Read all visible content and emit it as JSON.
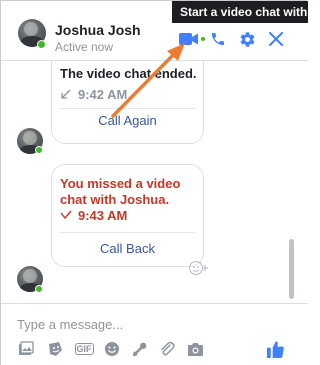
{
  "header": {
    "contact_name": "Joshua Josh",
    "status": "Active now",
    "tooltip": "Start a video chat with",
    "icons": [
      "video-camera-icon",
      "phone-icon",
      "gear-icon",
      "close-icon"
    ]
  },
  "messages": [
    {
      "text": "The video chat ended.",
      "time": "9:42 AM",
      "action": "Call Again",
      "call_direction": "outgoing"
    },
    {
      "text": "You missed a video chat with Joshua.",
      "time": "9:43 AM",
      "action": "Call Back",
      "call_direction": "missed"
    }
  ],
  "composer": {
    "placeholder": "Type a message...",
    "tools": [
      "photo-icon",
      "sticker-icon",
      "gif-icon",
      "emoji-icon",
      "game-icon",
      "attachment-icon",
      "camera-icon",
      "thumbs-up-icon"
    ],
    "gif_label": "GIF"
  },
  "colors": {
    "accent": "#4080ff",
    "online": "#42b72a",
    "missed": "#c0392b",
    "link": "#365899",
    "annotation_arrow": "#ec7c30"
  }
}
